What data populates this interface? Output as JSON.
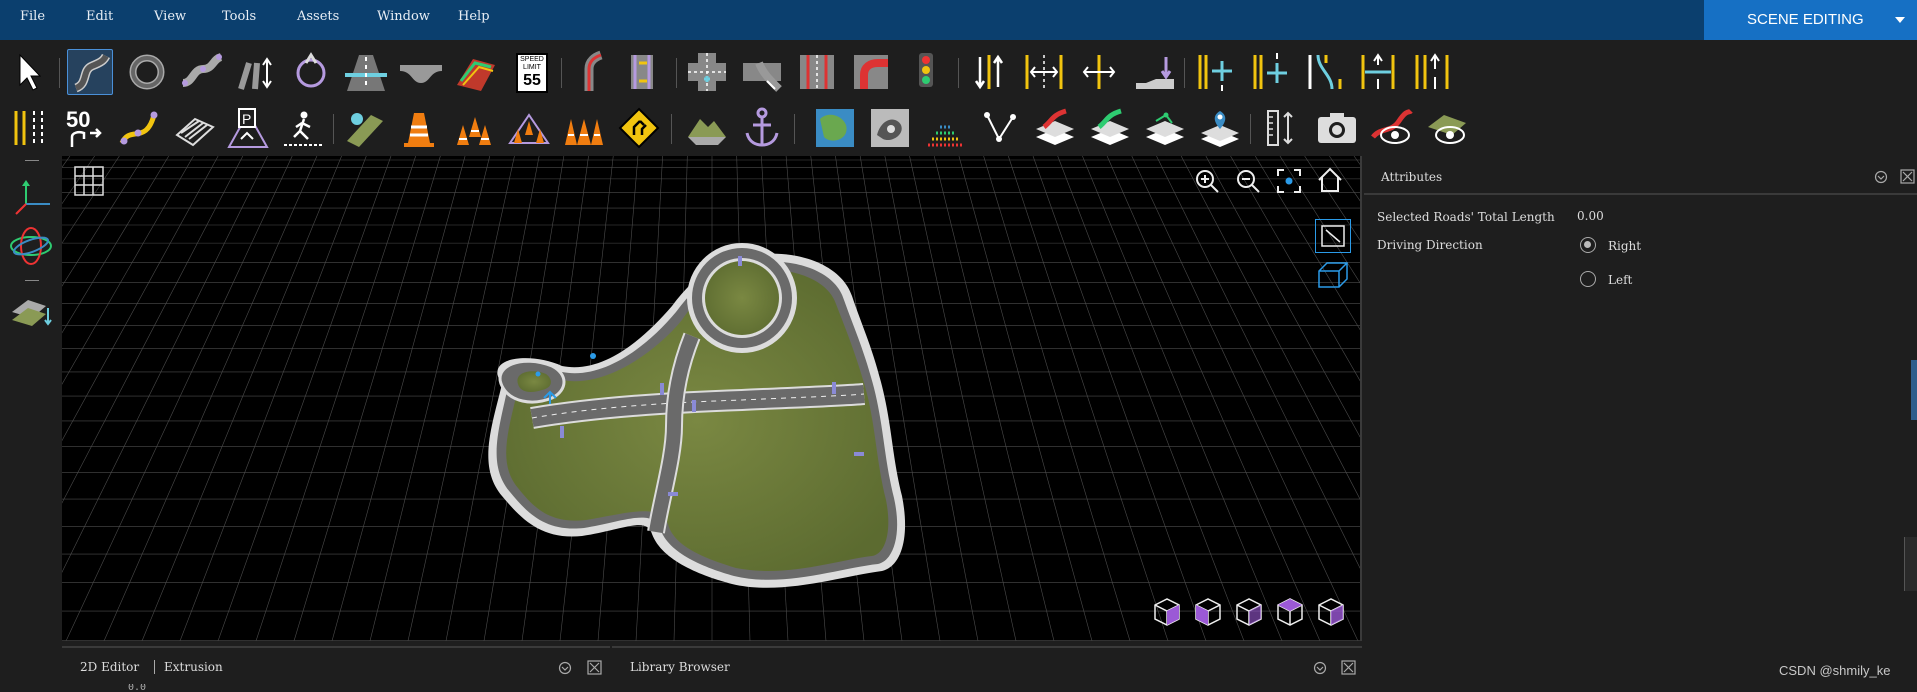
{
  "menubar": {
    "items": [
      "File",
      "Edit",
      "View",
      "Tools",
      "Assets",
      "Window",
      "Help"
    ],
    "mode_label": "SCENE EDITING"
  },
  "toolbar_row1": {
    "icons": [
      "select-arrow-icon",
      "road-curve-icon",
      "roundabout-icon",
      "road-spline-icon",
      "road-split-icon",
      "lane-rotate-icon",
      "highway-icon",
      "bridge-icon",
      "road-paint-icon",
      "speed-limit-sign-icon",
      "road-fork-icon",
      "lane-shift-icon",
      "junction-icon",
      "junction-curve-icon",
      "junction-straight-icon",
      "junction-turn-icon",
      "traffic-light-icon",
      "lane-direction-icon",
      "lane-width-icon",
      "lane-width-adjust-icon",
      "lane-elevation-icon",
      "lane-marking-add-icon",
      "lane-marking-add2-icon",
      "lane-marking-curve-icon",
      "lane-marking-split-icon",
      "lane-marking-join-icon"
    ],
    "speed_sign": {
      "top": "SPEED",
      "mid": "LIMIT",
      "value": "55"
    }
  },
  "toolbar_row2": {
    "icons": [
      "lane-marking-icon",
      "speed-limit-marking-icon",
      "path-spline-icon",
      "crosswalk-area-icon",
      "parking-icon",
      "pedestrian-crossing-icon",
      "prop-place-icon",
      "traffic-cone-icon",
      "cone-row-icon",
      "cone-area-icon",
      "cone-set-icon",
      "yield-sign-icon",
      "terrain-icon",
      "anchor-icon",
      "satellite-image-icon",
      "elevation-map-icon",
      "point-cloud-icon",
      "scenario-path-icon",
      "layer-road-icon",
      "layer-road-green-icon",
      "layer-points-icon",
      "layer-pin-icon",
      "measure-icon",
      "camera-icon",
      "road-visibility-icon",
      "scene-visibility-icon"
    ],
    "speed_marking_value": "50"
  },
  "attributes": {
    "title": "Attributes",
    "total_length_label": "Selected Roads' Total Length",
    "total_length_value": "0.00",
    "driving_direction_label": "Driving Direction",
    "options": [
      {
        "label": "Right",
        "selected": true
      },
      {
        "label": "Left",
        "selected": false
      }
    ]
  },
  "bottom": {
    "panel1_title": "2D Editor",
    "panel1_tab": "Extrusion",
    "panel2_title": "Library Browser",
    "panel1_partial_value": "0.0"
  },
  "watermark": "CSDN @shmily_ke",
  "colors": {
    "menubar": "#0b3f6e",
    "mode_button": "#1670c4",
    "grass": "#6b7a3a",
    "road": "#6e6e6e",
    "selection_blue": "#4a90d9"
  }
}
